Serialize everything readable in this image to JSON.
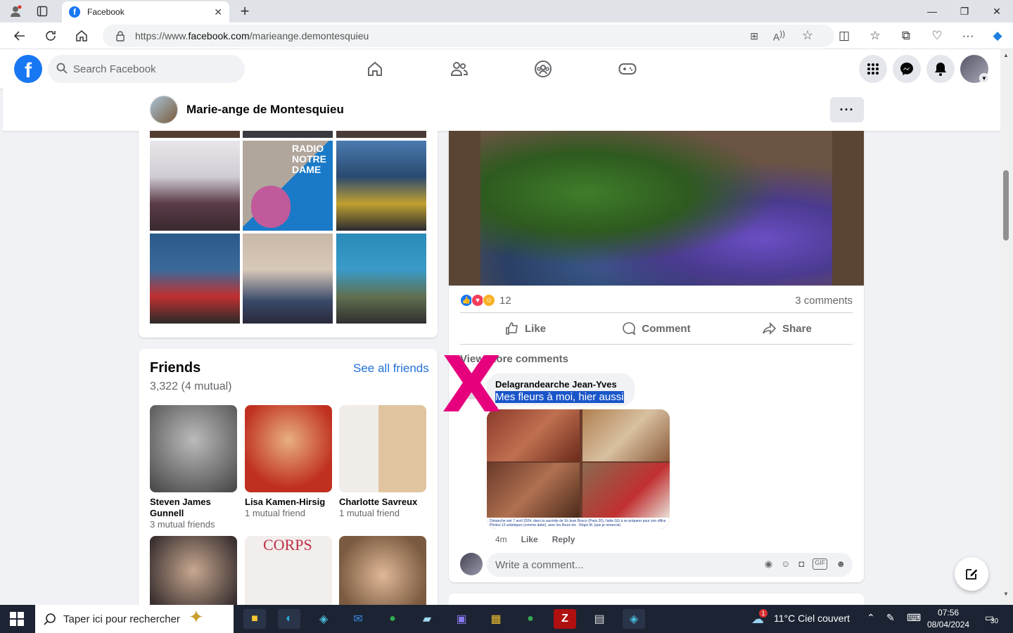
{
  "browser": {
    "tab_title": "Facebook",
    "url_prefix": "https://www.",
    "url_domain": "facebook.com",
    "url_path": "/marieange.demontesquieu"
  },
  "fb": {
    "search_placeholder": "Search Facebook"
  },
  "profile": {
    "name": "Marie-ange de Montesquieu",
    "more_label": "···"
  },
  "photos": {
    "colors": [
      "#7a5a52",
      "#4a6fa5",
      "#c9b48a",
      "#2d4c7a",
      "#d8c8b0",
      "#6a7aa8"
    ]
  },
  "friends": {
    "title": "Friends",
    "see_all": "See all friends",
    "count": "3,322 (4 mutual)",
    "items": [
      {
        "name": "Steven James Gunnell",
        "mutual": "3 mutual friends",
        "color": "#555555"
      },
      {
        "name": "Lisa Kamen-Hirsig",
        "mutual": "1 mutual friend",
        "color": "#c8402f"
      },
      {
        "name": "Charlotte Savreux",
        "mutual": "1 mutual friend",
        "color": "#d9d2c8"
      },
      {
        "name": "",
        "mutual": "",
        "color": "#7a6a5e"
      },
      {
        "name": "",
        "mutual": "",
        "color": "#e6e0dc"
      },
      {
        "name": "",
        "mutual": "",
        "color": "#c99a7a"
      }
    ],
    "row2_title_text": "CORPS"
  },
  "post": {
    "reaction_count": "12",
    "comments_count": "3 comments",
    "like": "Like",
    "comment": "Comment",
    "share": "Share",
    "view_more": "View more comments",
    "comment_author": "Delagrandearche Jean-Yves",
    "comment_text_selected": "Mes fleurs à moi, hier aussi",
    "comment_text_rest": " :",
    "comment_caption": "Dimanche soir 7 avril 2024, dans la sacristie de St-Jean Bosco (Paris 20), l'aide GG à se préparer pour son office. Photos 13 artistiques (comme dabe), avec les fleurs etc : Régis M. (que je remercie)",
    "comment_time": "4m",
    "comment_like": "Like",
    "comment_reply": "Reply",
    "write_placeholder": "Write a comment..."
  },
  "overlay": {
    "mark": "X",
    "mark_color": "#e6007e"
  },
  "taskbar": {
    "search_placeholder": "Taper ici pour rechercher",
    "weather": "11°C  Ciel couvert",
    "time": "07:56",
    "date": "08/04/2024",
    "notif_count": "30",
    "weather_badge": "1"
  }
}
